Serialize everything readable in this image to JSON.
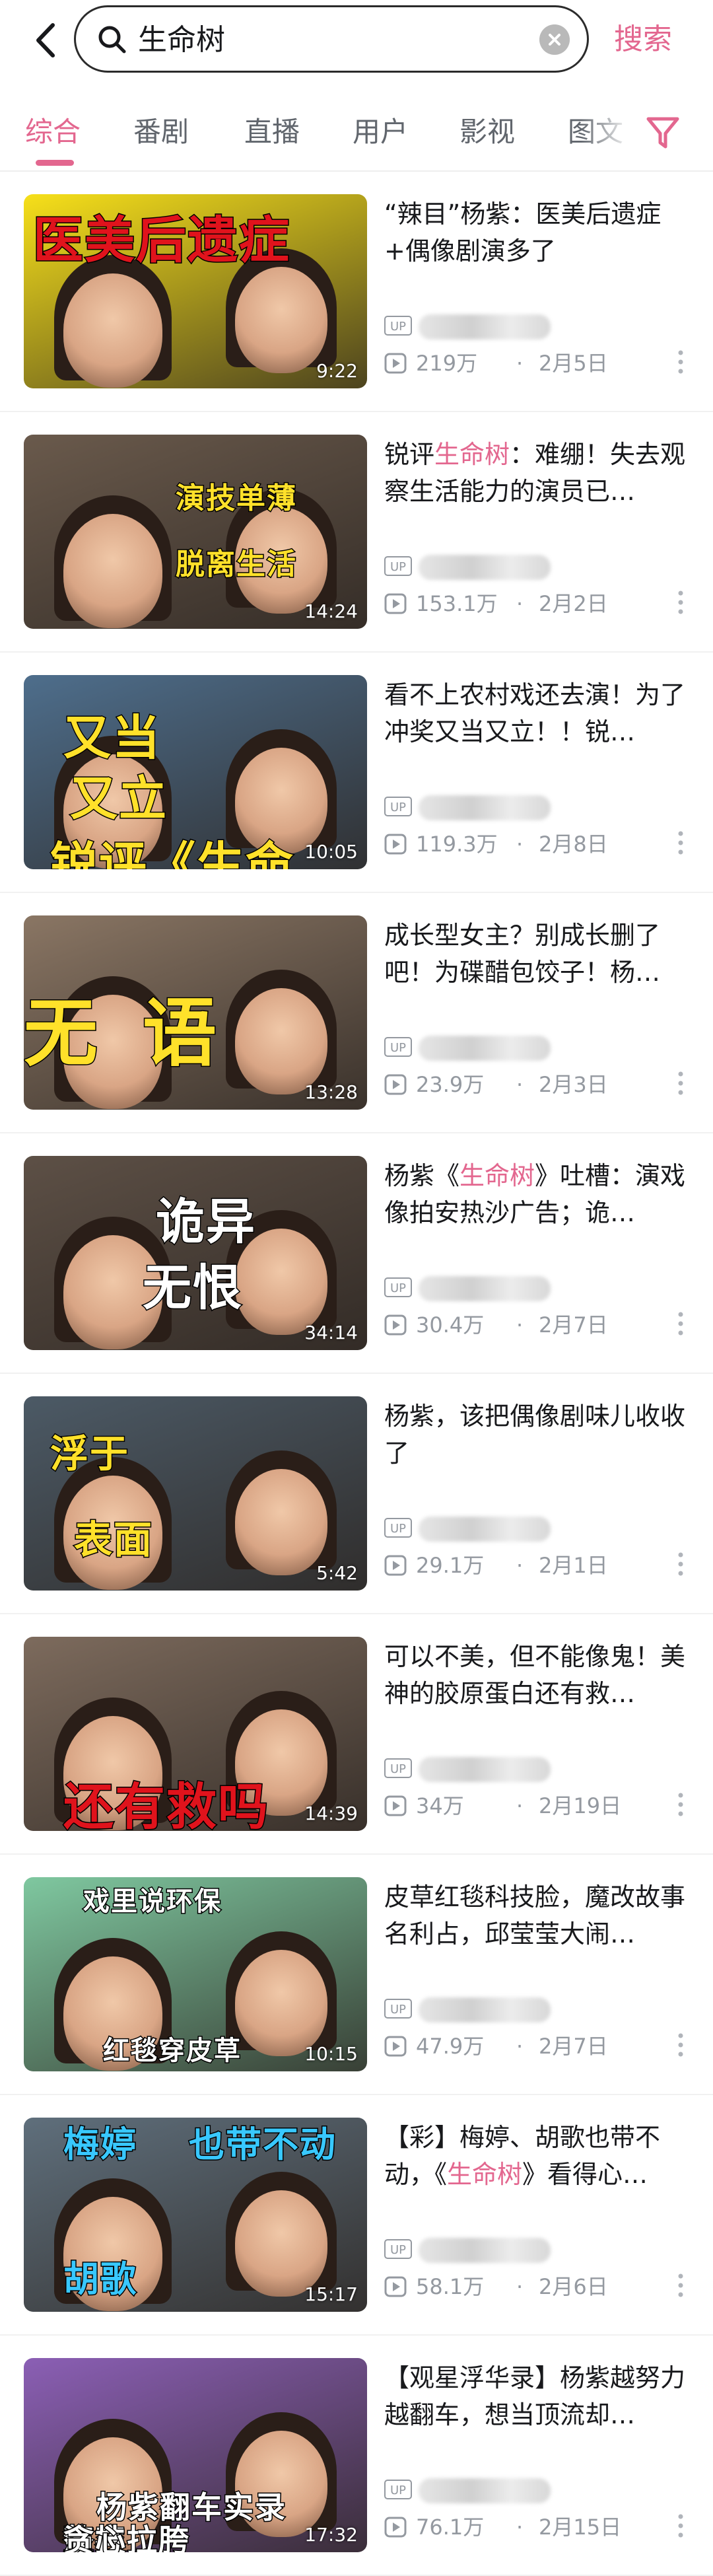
{
  "search": {
    "query": "生命树",
    "button": "搜索"
  },
  "tabs": [
    "综合",
    "番剧",
    "直播",
    "用户",
    "影视",
    "图文"
  ],
  "colors": {
    "accent": "#e3678f",
    "meta": "#9499a0"
  },
  "icons": {
    "back": "chevron-left-icon",
    "search": "search-icon",
    "clear": "clear-icon",
    "filter": "filter-icon",
    "play": "play-icon",
    "more": "more-icon"
  },
  "videos": [
    {
      "title_pre": "“辣目”杨紫：医美后遗症+偶像剧演多了",
      "title_hl": "",
      "title_post": "",
      "thumb_caption": "医美后遗症",
      "duration": "9:22",
      "views": "219万",
      "date": "2月5日",
      "thumb_bg": "#f7e01a"
    },
    {
      "title_pre": "锐评",
      "title_hl": "生命树",
      "title_post": "：难绷！失去观察生活能力的演员已…",
      "thumb_caption": "演技单薄 脱离生活",
      "duration": "14:24",
      "views": "153.1万",
      "date": "2月2日",
      "thumb_bg": "#6a5a4c"
    },
    {
      "title_pre": "看不上农村戏还去演！为了冲奖又当又立！！锐…",
      "title_hl": "",
      "title_post": "",
      "thumb_caption": "又当 又立 锐评《生命树》",
      "duration": "10:05",
      "views": "119.3万",
      "date": "2月8日",
      "thumb_bg": "#4e6e8c"
    },
    {
      "title_pre": "成长型女主？别成长删了吧！为碟醋包饺子！杨…",
      "title_hl": "",
      "title_post": "",
      "thumb_caption": "无 语",
      "duration": "13:28",
      "views": "23.9万",
      "date": "2月3日",
      "thumb_bg": "#8a7664"
    },
    {
      "title_pre": "杨紫《",
      "title_hl": "生命树",
      "title_post": "》吐槽：演戏像拍安热沙广告；诡…",
      "thumb_caption": "诡异 无恨",
      "duration": "34:14",
      "views": "30.4万",
      "date": "2月7日",
      "thumb_bg": "#5d5046"
    },
    {
      "title_pre": "杨紫，该把偶像剧味儿收收了",
      "title_hl": "",
      "title_post": "",
      "thumb_caption": "浮于 表面",
      "duration": "5:42",
      "views": "29.1万",
      "date": "2月1日",
      "thumb_bg": "#4c5a66"
    },
    {
      "title_pre": "可以不美，但不能像鬼！美神的胶原蛋白还有救…",
      "title_hl": "",
      "title_post": "",
      "thumb_caption": "还有救吗",
      "duration": "14:39",
      "views": "34万",
      "date": "2月19日",
      "thumb_bg": "#7d6b5d"
    },
    {
      "title_pre": "皮草红毯科技脸，魔改故事名利占，邱莹莹大闹…",
      "title_hl": "",
      "title_post": "",
      "thumb_caption": "戏里说环保 红毯穿皮草",
      "duration": "10:15",
      "views": "47.9万",
      "date": "2月7日",
      "thumb_bg": "#7fc8a0"
    },
    {
      "title_pre": "【彩】梅婷、胡歌也带不动，《",
      "title_hl": "生命树",
      "title_post": "》看得心…",
      "thumb_caption": "梅婷 胡歌 也带不动",
      "duration": "15:17",
      "views": "58.1万",
      "date": "2月6日",
      "thumb_bg": "#5f6f7c"
    },
    {
      "title_pre": "【观星浮华录】杨紫越努力越翻车，想当顶流却…",
      "title_hl": "",
      "title_post": "",
      "thumb_caption": "杨紫翻车实录 整容 演技拉胯 贪心",
      "duration": "17:32",
      "views": "76.1万",
      "date": "2月15日",
      "thumb_bg": "#8b5fb5"
    }
  ]
}
